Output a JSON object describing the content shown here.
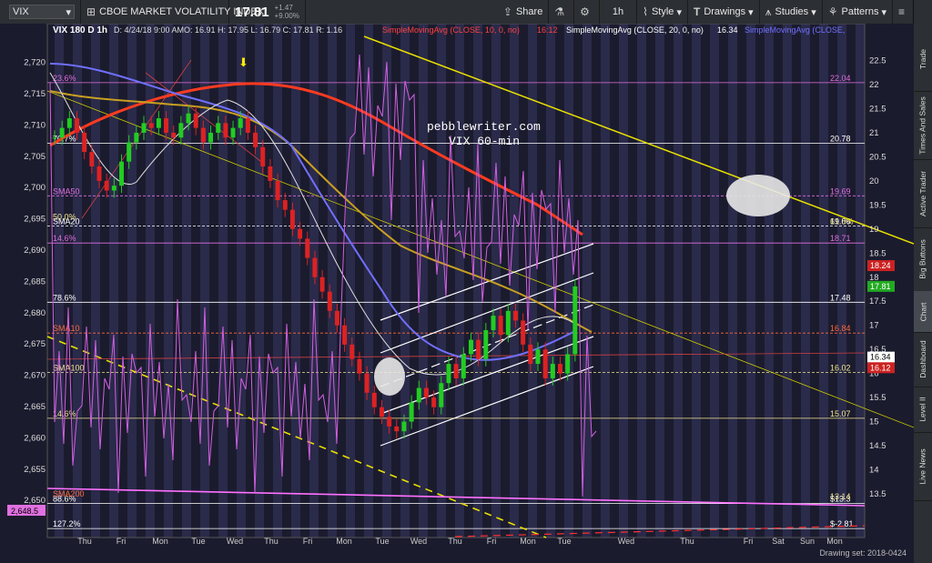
{
  "toolbar": {
    "symbol": "VIX",
    "title": "CBOE MARKET VOLATILITY INDEX",
    "last": "17.81",
    "change": "+1.47",
    "change_pct": "+9.00%",
    "share": "Share",
    "interval": "1h",
    "style": "Style",
    "drawings": "Drawings",
    "studies": "Studies",
    "patterns": "Patterns"
  },
  "sidebar": [
    "Trade",
    "Times And Sales",
    "Active Trader",
    "Big Buttons",
    "Chart",
    "Dashboard",
    "Level II",
    "Live News"
  ],
  "chart_header": {
    "desc": "VIX 180 D 1h",
    "date": "D: 4/24/18 9:00 AM",
    "ohlc": "O: 16.91  H: 17.95  L: 16.79  C: 17.81  R: 1.16",
    "sma10": "SimpleMovingAvg (CLOSE, 10, 0, no)",
    "sma10_val": "16:12",
    "sma20": "SimpleMovingAvg (CLOSE, 20, 0, no)",
    "sma20_val": "16.34",
    "sma_more": "SimpleMovingAvg (CLOSE,"
  },
  "annotation": {
    "line1": "pebblewriter.com",
    "line2": "VIX 60-min"
  },
  "chart_data": {
    "type": "candlestick",
    "left_axis": {
      "ticks": [
        2720,
        2715,
        2710,
        2705,
        2700,
        2695,
        2690,
        2685,
        2680,
        2675,
        2670,
        2665,
        2660,
        2655,
        2650
      ],
      "ylim": [
        2644.5,
        2723
      ]
    },
    "right_axis": {
      "ticks": [
        "22.5",
        "22",
        "21.5",
        "21",
        "20.5",
        "20",
        "19.5",
        "19",
        "18.5",
        "18",
        "17.5",
        "17",
        "16.5",
        "16",
        "15.5",
        "15",
        "14.5",
        "14",
        "13.5"
      ],
      "ylim": [
        12.65,
        22.85
      ]
    },
    "x_labels": [
      "Thu",
      "Fri",
      "Mon",
      "Tue",
      "Wed",
      "Thu",
      "Fri",
      "Mon",
      "Tue",
      "Wed",
      "Thu",
      "Fri",
      "Mon",
      "Tue",
      "Wed",
      "Thu",
      "Fri",
      "Sat",
      "Sun",
      "Mon"
    ],
    "fib_levels": [
      {
        "label": "23.6%",
        "value": "22.04",
        "color": "#e070e0",
        "y": 22.04
      },
      {
        "label": "70.7%",
        "value": "20.78",
        "color": "#ffffff",
        "y": 20.78
      },
      {
        "label": "SMA50",
        "value": "19.69",
        "color": "#e070e0",
        "y": 19.69
      },
      {
        "label": "SMA20",
        "value": "19.06",
        "color": "#ffffff",
        "y": 19.06
      },
      {
        "label": "14.6%",
        "value": "18.71",
        "color": "#e070e0",
        "y": 18.71
      },
      {
        "label": "78.6%",
        "value": "17.48",
        "color": "#ffffff",
        "y": 17.48
      },
      {
        "label": "SMA10",
        "value": "16.84",
        "color": "#ff6a3a",
        "y": 16.84
      },
      {
        "label": "SMA100",
        "value": "16.02",
        "color": "#f0e68c",
        "y": 16.02
      },
      {
        "label": "14.6%",
        "value": "15.07",
        "color": "#f0e68c",
        "y": 15.07
      },
      {
        "label": "88.6%",
        "value": "$13.3",
        "color": "#ffffff",
        "y": 13.3
      },
      {
        "label": "127.2%",
        "value": "$-2.81",
        "color": "#ffffff",
        "y": 12.78
      }
    ],
    "extra_labels": [
      "SMA200",
      "50.0%",
      "61.8%",
      "13.14"
    ],
    "price_badges": [
      {
        "value": "18.24",
        "color": "#cc2222"
      },
      {
        "value": "17.81",
        "color": "#22aa22"
      },
      {
        "value": "16.34",
        "color": "#ffffff"
      },
      {
        "value": "16.12",
        "color": "#cc2222"
      }
    ],
    "left_badge": "2,648.5",
    "candles_close": [
      20.9,
      21.1,
      21.3,
      21.0,
      20.6,
      20.3,
      20.0,
      19.8,
      19.9,
      20.4,
      20.8,
      21.0,
      21.2,
      21.1,
      21.3,
      21.0,
      20.9,
      21.2,
      21.4,
      21.1,
      20.8,
      21.0,
      21.2,
      20.9,
      21.1,
      21.3,
      21.0,
      20.7,
      20.3,
      20.0,
      19.6,
      19.4,
      19.0,
      18.8,
      18.4,
      18.0,
      17.7,
      17.3,
      17.0,
      16.6,
      16.3,
      16.0,
      15.6,
      15.3,
      15.1,
      14.9,
      14.8,
      15.0,
      15.4,
      15.7,
      15.5,
      15.3,
      15.8,
      16.2,
      15.9,
      16.4,
      16.7,
      16.3,
      16.9,
      17.2,
      16.8,
      17.3,
      17.1,
      16.6,
      16.2,
      16.5,
      15.9,
      16.2,
      16.0,
      16.4,
      17.81
    ]
  },
  "status": {
    "drawing_set": "Drawing set: 2018-0424"
  }
}
